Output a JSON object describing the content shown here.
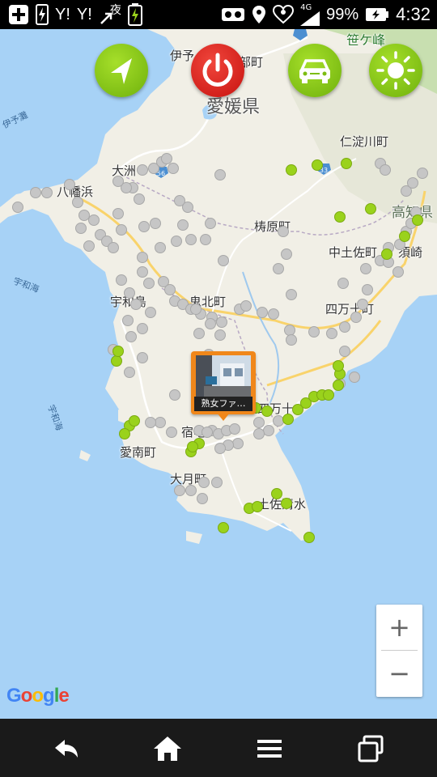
{
  "status_bar": {
    "ymobile_1": "Y!",
    "ymobile_2": "Y!",
    "night_label": "夜",
    "network": "4G",
    "battery": "99%",
    "time": "4:32"
  },
  "map": {
    "place_labels": [
      {
        "text": "伊予",
        "cls": ""
      },
      {
        "text": "部町",
        "cls": ""
      },
      {
        "text": "愛媛県",
        "cls": "big"
      },
      {
        "text": "笹ケ峰",
        "cls": "green"
      },
      {
        "text": "仁淀川町",
        "cls": ""
      },
      {
        "text": "八幡浜",
        "cls": ""
      },
      {
        "text": "大洲",
        "cls": ""
      },
      {
        "text": "高知県",
        "cls": "pref"
      },
      {
        "text": "梼原町",
        "cls": ""
      },
      {
        "text": "中土佐町",
        "cls": ""
      },
      {
        "text": "須崎",
        "cls": ""
      },
      {
        "text": "宇和島",
        "cls": ""
      },
      {
        "text": "鬼北町",
        "cls": ""
      },
      {
        "text": "四万十町",
        "cls": ""
      },
      {
        "text": "四万十",
        "cls": ""
      },
      {
        "text": "宿毛",
        "cls": ""
      },
      {
        "text": "愛南町",
        "cls": ""
      },
      {
        "text": "大月町",
        "cls": ""
      },
      {
        "text": "土佐清水",
        "cls": ""
      },
      {
        "text": "伊予灘",
        "cls": "sea"
      },
      {
        "text": "宇和海",
        "cls": "sea"
      },
      {
        "text": "宇和海",
        "cls": "sea"
      }
    ],
    "marker_label": "熟女ファ…",
    "zoom_in_label": "+",
    "zoom_out_label": "−",
    "attribution": [
      "G",
      "o",
      "o",
      "g",
      "l",
      "e"
    ],
    "attribution_colors": [
      "#4285f4",
      "#ea4335",
      "#fbbc05",
      "#4285f4",
      "#34a853",
      "#ea4335"
    ],
    "land_color": "#f1efe6",
    "water_color": "#a7d2f6",
    "green_dot_color": "#9ad21c",
    "gray_dot_color": "#c6c6c6"
  },
  "controls": {
    "locate_icon": "navigation-arrow-icon",
    "power_icon": "power-icon",
    "car_icon": "car-icon",
    "brightness_icon": "sun-icon"
  },
  "nav_bar": {
    "back_icon": "back-icon",
    "home_icon": "home-icon",
    "menu_icon": "menu-icon",
    "recents_icon": "recents-icon"
  }
}
